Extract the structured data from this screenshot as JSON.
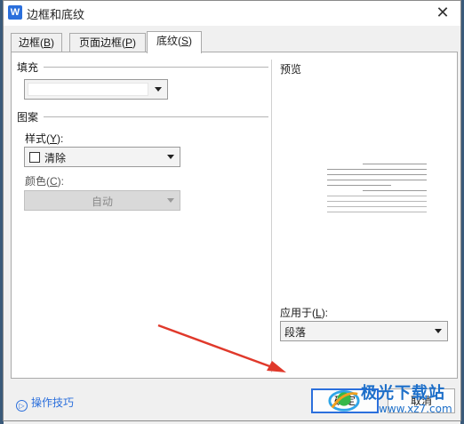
{
  "window": {
    "title": "边框和底纹",
    "app_icon": "W"
  },
  "tabs": [
    {
      "label": "边框(",
      "key": "B",
      "close": ")",
      "active": false
    },
    {
      "label": "页面边框(",
      "key": "P",
      "close": ")",
      "active": false
    },
    {
      "label": "底纹(",
      "key": "S",
      "close": ")",
      "active": true
    }
  ],
  "fill": {
    "group_label": "填充",
    "color_value": ""
  },
  "pattern": {
    "group_label": "图案",
    "style_label": "样式(",
    "style_key": "Y",
    "style_close": "):",
    "style_value": "清除",
    "color_label": "颜色(",
    "color_key": "C",
    "color_close": "):",
    "color_value": "自动"
  },
  "preview": {
    "label": "预览"
  },
  "apply": {
    "label": "应用于(",
    "key": "L",
    "close": "):",
    "value": "段落"
  },
  "footer": {
    "help_link": "操作技巧",
    "ok": "确定",
    "cancel": "取消"
  },
  "watermark": {
    "brand": "极光下载站",
    "url": "www.xz7.com"
  },
  "colors": {
    "accent": "#2b6fdc",
    "arrow": "#e0392b"
  },
  "icons": {
    "close": "close-icon",
    "help": "help-circle-icon",
    "dropdown": "chevron-down-icon"
  }
}
